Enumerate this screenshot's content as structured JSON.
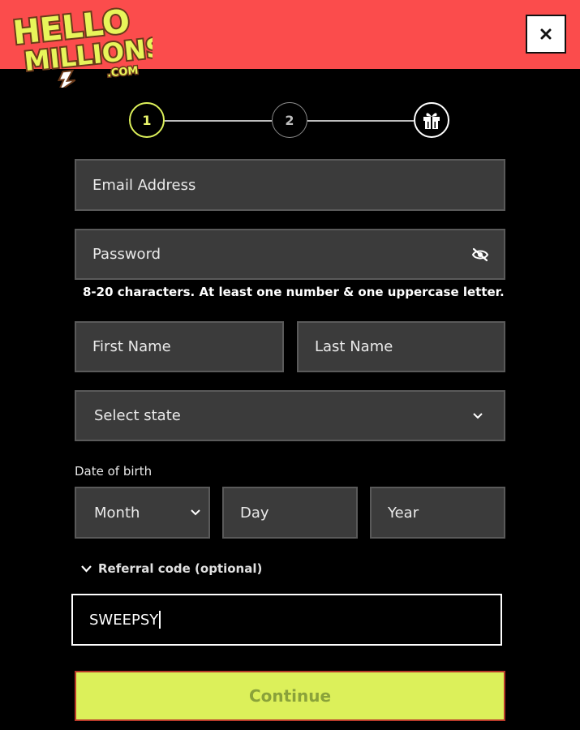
{
  "brand": {
    "logo_line1": "HELLO",
    "logo_line2": "MILLIONS",
    "logo_line3": ".COM"
  },
  "header": {
    "close_label": "×"
  },
  "stepper": {
    "step1": "1",
    "step2": "2",
    "step3_icon": "gift-icon"
  },
  "form": {
    "email_placeholder": "Email Address",
    "password_placeholder": "Password",
    "password_hint": "8-20 characters. At least one number & one uppercase letter.",
    "first_name_placeholder": "First Name",
    "last_name_placeholder": "Last Name",
    "state_select": "Select state",
    "dob_label": "Date of birth",
    "month_select": "Month",
    "day_placeholder": "Day",
    "year_placeholder": "Year",
    "referral_toggle": "Referral code (optional)",
    "referral_value": "SWEEPSY",
    "continue_label": "Continue"
  },
  "colors": {
    "header_bg": "#fb4c4c",
    "accent": "#dcf05a",
    "field_bg": "#3b3b3b",
    "page_bg": "#000000"
  }
}
